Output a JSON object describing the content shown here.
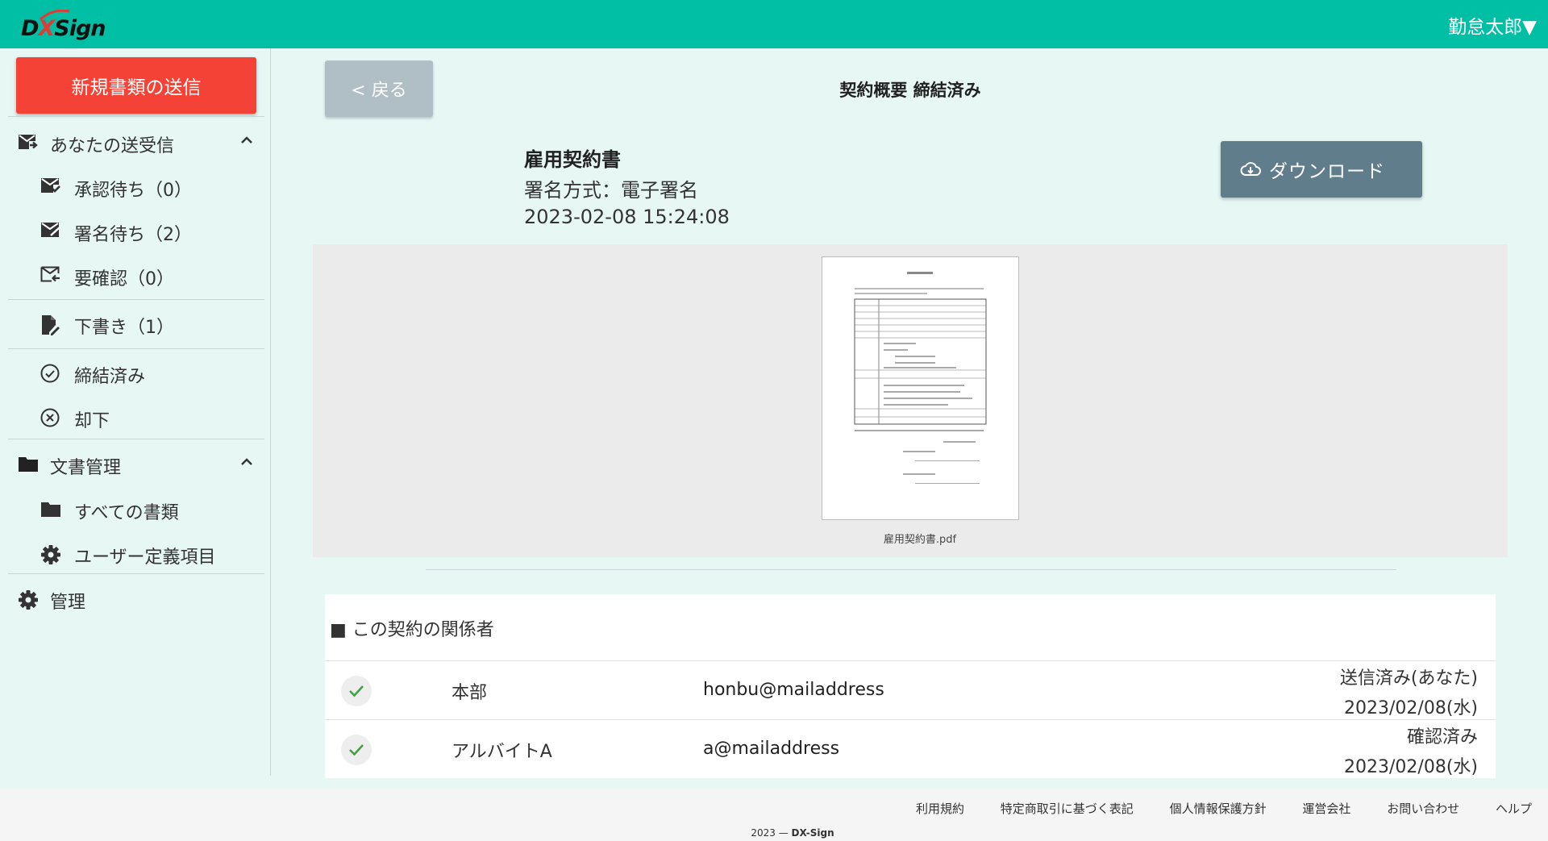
{
  "app": {
    "logo_text_a": "D",
    "logo_text_x": "X",
    "logo_text_b": "Sign"
  },
  "header": {
    "user_menu": "勤怠太郎▼"
  },
  "sidebar": {
    "new_doc_label": "新規書類の送信",
    "section_inbox": "あなたの送受信",
    "items": [
      {
        "label": "承認待ち（0）"
      },
      {
        "label": "署名待ち（2）"
      },
      {
        "label": "要確認（0）"
      },
      {
        "label": "下書き（1）"
      },
      {
        "label": "締結済み"
      },
      {
        "label": "却下"
      }
    ],
    "section_docs": "文書管理",
    "doc_items": [
      {
        "label": "すべての書類"
      },
      {
        "label": "ユーザー定義項目"
      }
    ],
    "admin_label": "管理"
  },
  "main": {
    "back_label": "< 戻る",
    "page_title": "契約概要 締結済み",
    "doc_title": "雇用契約書",
    "sign_method": "署名方式：電子署名",
    "doc_datetime": "2023-02-08 15:24:08",
    "download_label": "ダウンロード",
    "file_name": "雇用契約書.pdf",
    "parties_heading": "■ この契約の関係者",
    "parties": [
      {
        "name": "本部",
        "email": "honbu@mailaddress",
        "status": "送信済み(あなた)",
        "date": "2023/02/08(水)"
      },
      {
        "name": "アルバイトA",
        "email": "a@mailaddress",
        "status": "確認済み",
        "date": "2023/02/08(水)"
      }
    ]
  },
  "footer": {
    "links": [
      "利用規約",
      "特定商取引に基づく表記",
      "個人情報保護方針",
      "運営会社",
      "お問い合わせ",
      "ヘルプ"
    ],
    "copyright_year": "2023 — ",
    "copyright_brand": "DX-Sign"
  },
  "colors": {
    "header": "#00bfa5",
    "primary_red": "#f44336",
    "download": "#607d8b",
    "back": "#b0bec5",
    "check": "#43a047"
  }
}
